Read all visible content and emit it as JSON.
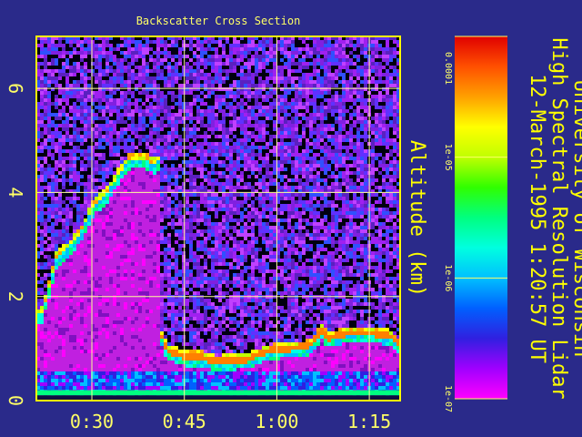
{
  "chart_data": {
    "type": "heatmap",
    "title": "Backscatter Cross Section",
    "ylabel": "Altitude (km)",
    "xlabel": "",
    "x_ticks": [
      "0:30",
      "0:45",
      "1:00",
      "1:15"
    ],
    "x_tick_values_min": [
      30,
      45,
      60,
      75
    ],
    "xlim_min": [
      21,
      80
    ],
    "y_ticks": [
      "0",
      "2",
      "4",
      "6"
    ],
    "y_tick_values": [
      0,
      2,
      4,
      6
    ],
    "ylim": [
      0,
      7
    ],
    "grid": true,
    "colorbar": {
      "scale": "log",
      "range": [
        1e-07,
        0.0001
      ],
      "tick_labels": [
        "0.0001",
        "1e-05",
        "1e-06",
        "1e-07"
      ],
      "tick_values": [
        0.0001,
        1e-05,
        1e-06,
        1e-07
      ]
    },
    "cloud_top_profile": {
      "x_min": [
        21.5,
        22.5,
        24,
        26,
        28,
        30,
        32,
        34,
        36,
        38,
        40,
        41
      ],
      "top_km": [
        1.8,
        2.2,
        2.9,
        3.1,
        3.4,
        3.9,
        4.1,
        4.5,
        4.8,
        4.8,
        4.7,
        4.8
      ]
    },
    "boundary_layer_profile": {
      "x_min": [
        41,
        42,
        45,
        47,
        50,
        55,
        58,
        61,
        65,
        67,
        68,
        71,
        75,
        78,
        80
      ],
      "top_km": [
        1.4,
        1.1,
        1.0,
        1.0,
        0.9,
        0.95,
        1.1,
        1.15,
        1.2,
        1.5,
        1.35,
        1.45,
        1.45,
        1.4,
        1.2
      ]
    },
    "colors": {
      "background": "#2a2a8a",
      "frame": "#ffff00",
      "text": "#ffff66",
      "grid": "#ffff99",
      "noise": "#a020f0",
      "cloud_interior": "#c020e0",
      "cloud_edge": "#ffff00",
      "layer_core": "#ff8000",
      "colormap": [
        "#ff00ff",
        "#a000ff",
        "#3020e0",
        "#0060ff",
        "#00c0ff",
        "#00ffe0",
        "#00ff80",
        "#30ff00",
        "#c0ff00",
        "#ffff00",
        "#ffa000",
        "#ff5000",
        "#e00000"
      ]
    }
  },
  "side_text": {
    "line1": "University of Wisconsin",
    "line2": "High Spectral Resolution Lidar",
    "line3": "12-March-1995   1:20:57 UT"
  }
}
